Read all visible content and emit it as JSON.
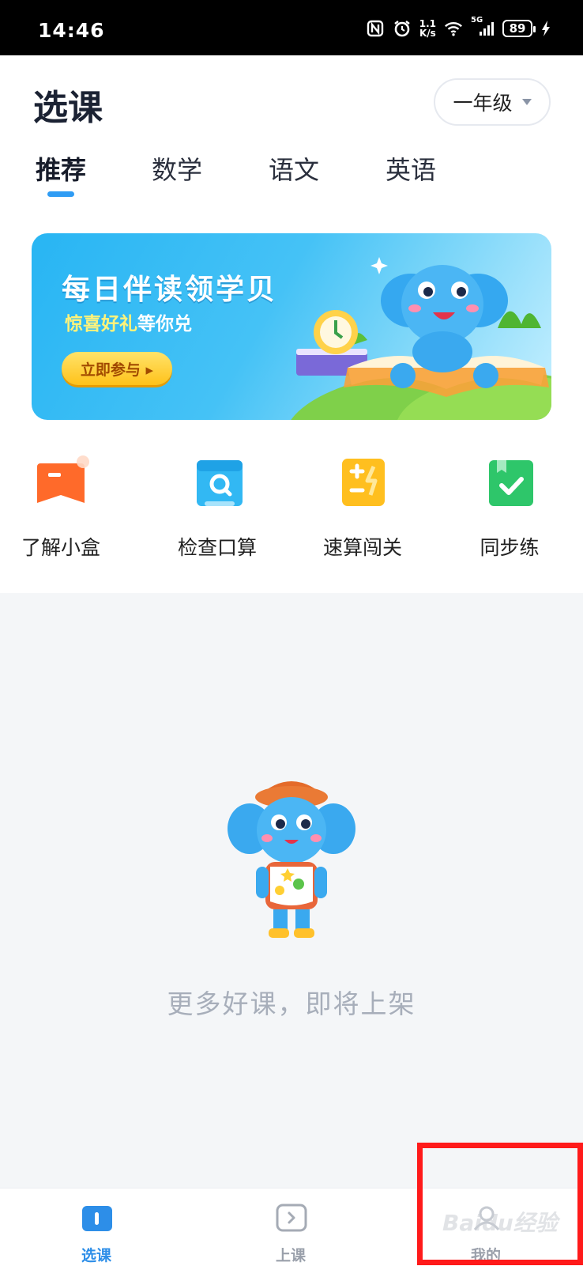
{
  "status_bar": {
    "time": "14:46",
    "network_speed_value": "1.1",
    "network_speed_unit": "K/s",
    "signal_label": "5G",
    "battery": "89",
    "icons": [
      "nfc-icon",
      "alarm-icon",
      "wifi-icon",
      "signal-icon",
      "battery-icon",
      "charging-icon"
    ]
  },
  "header": {
    "title": "选课",
    "grade_select": "一年级"
  },
  "tabs": [
    {
      "label": "推荐",
      "active": true
    },
    {
      "label": "数学",
      "active": false
    },
    {
      "label": "语文",
      "active": false
    },
    {
      "label": "英语",
      "active": false
    }
  ],
  "banner": {
    "title": "每日伴读领学贝",
    "subtitle_highlight": "惊喜好礼",
    "subtitle_rest": "等你兑",
    "button": "立即参与 ▸"
  },
  "quick_entries": [
    {
      "label": "了解小盒",
      "icon": "box-intro-icon",
      "color": "#ff7a2e"
    },
    {
      "label": "检查口算",
      "icon": "search-check-icon",
      "color": "#2fb2f0"
    },
    {
      "label": "速算闯关",
      "icon": "calculator-icon",
      "color": "#ffc12b"
    },
    {
      "label": "同步练",
      "icon": "checklist-icon",
      "color": "#2ec66a"
    }
  ],
  "empty_state": {
    "message": "更多好课，即将上架"
  },
  "bottom_nav": [
    {
      "label": "选课",
      "icon": "book-icon",
      "active": true
    },
    {
      "label": "上课",
      "icon": "play-icon",
      "active": false
    },
    {
      "label": "我的",
      "icon": "profile-icon",
      "active": false
    }
  ],
  "watermark": "Baidu经验",
  "colors": {
    "accent": "#2f9cf4",
    "nav_active": "#2d8ee8",
    "highlight": "#ff1a1a"
  }
}
